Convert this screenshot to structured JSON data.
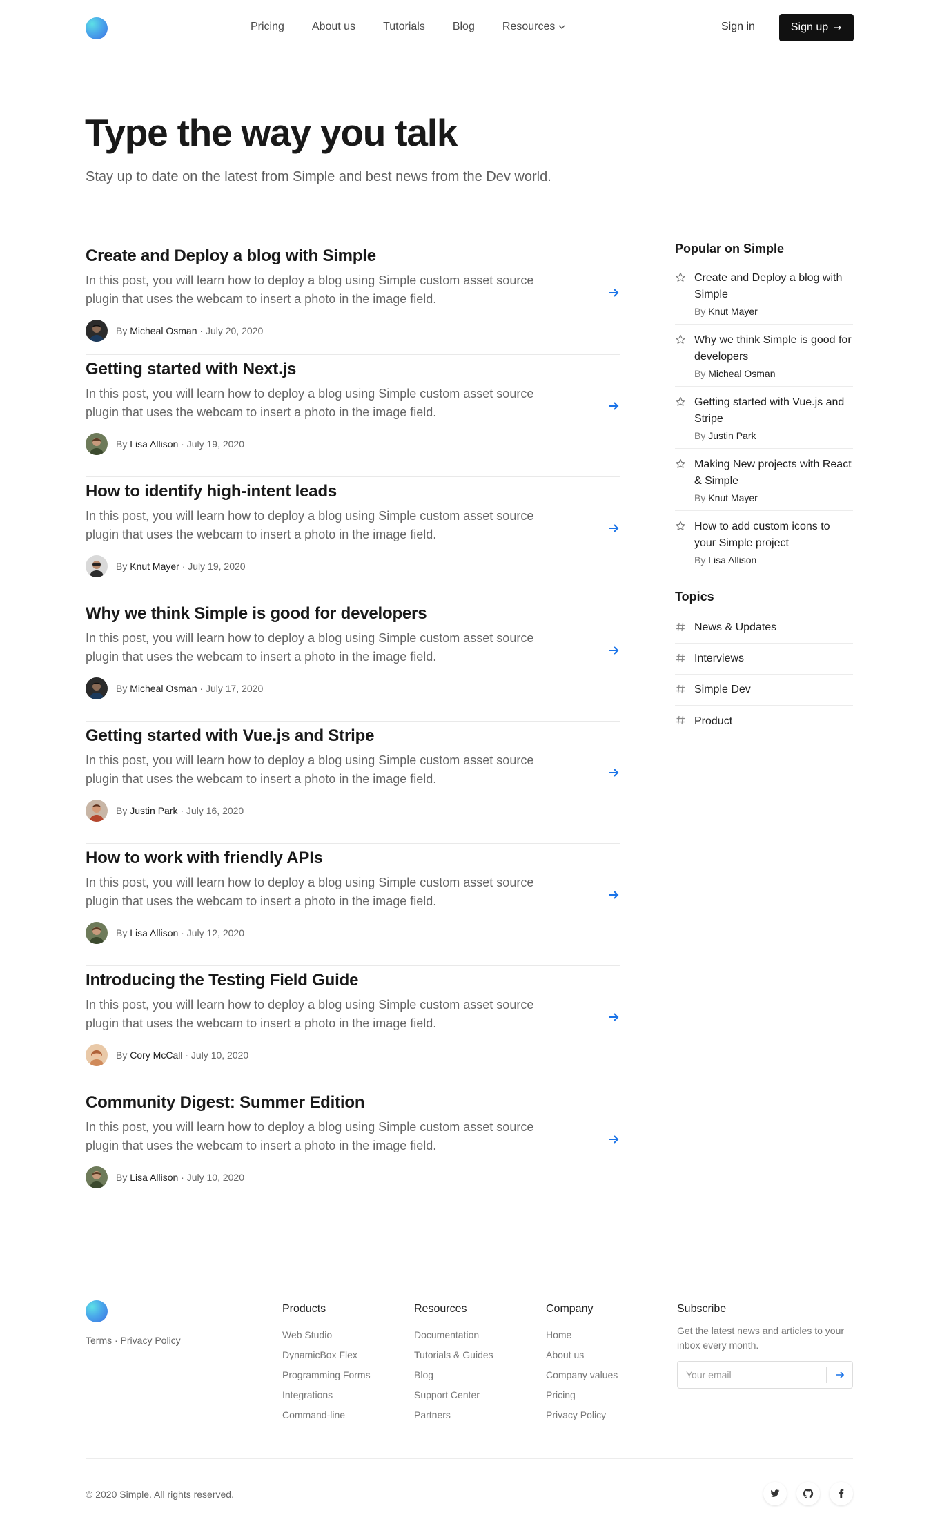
{
  "header": {
    "nav": [
      "Pricing",
      "About us",
      "Tutorials",
      "Blog",
      "Resources"
    ],
    "sign_in": "Sign in",
    "sign_up": "Sign up"
  },
  "hero": {
    "title": "Type the way you talk",
    "subtitle": "Stay up to date on the latest from Simple and best news from the Dev world."
  },
  "posts": [
    {
      "title": "Create and Deploy a blog with Simple",
      "desc": "In this post, you will learn how to deploy a blog using Simple custom asset source plugin that uses the webcam to insert a photo in the image field.",
      "by": "By",
      "author": "Micheal Osman",
      "date": "· July 20, 2020"
    },
    {
      "title": "Getting started with Next.js",
      "desc": "In this post, you will learn how to deploy a blog using Simple custom asset source plugin that uses the webcam to insert a photo in the image field.",
      "by": "By",
      "author": "Lisa Allison",
      "date": "· July 19, 2020"
    },
    {
      "title": "How to identify high-intent leads",
      "desc": "In this post, you will learn how to deploy a blog using Simple custom asset source plugin that uses the webcam to insert a photo in the image field.",
      "by": "By",
      "author": "Knut Mayer",
      "date": "· July 19, 2020"
    },
    {
      "title": "Why we think Simple is good for developers",
      "desc": "In this post, you will learn how to deploy a blog using Simple custom asset source plugin that uses the webcam to insert a photo in the image field.",
      "by": "By",
      "author": "Micheal Osman",
      "date": "· July 17, 2020"
    },
    {
      "title": "Getting started with Vue.js and Stripe",
      "desc": "In this post, you will learn how to deploy a blog using Simple custom asset source plugin that uses the webcam to insert a photo in the image field.",
      "by": "By",
      "author": "Justin Park",
      "date": "· July 16, 2020"
    },
    {
      "title": "How to work with friendly APIs",
      "desc": "In this post, you will learn how to deploy a blog using Simple custom asset source plugin that uses the webcam to insert a photo in the image field.",
      "by": "By",
      "author": "Lisa Allison",
      "date": "· July 12, 2020"
    },
    {
      "title": "Introducing the Testing Field Guide",
      "desc": "In this post, you will learn how to deploy a blog using Simple custom asset source plugin that uses the webcam to insert a photo in the image field.",
      "by": "By",
      "author": "Cory McCall",
      "date": "· July 10, 2020"
    },
    {
      "title": "Community Digest: Summer Edition",
      "desc": "In this post, you will learn how to deploy a blog using Simple custom asset source plugin that uses the webcam to insert a photo in the image field.",
      "by": "By",
      "author": "Lisa Allison",
      "date": "· July 10, 2020"
    }
  ],
  "sidebar": {
    "popular_heading": "Popular on Simple",
    "popular": [
      {
        "title": "Create and Deploy a blog with Simple",
        "by": "By",
        "author": "Knut Mayer"
      },
      {
        "title": "Why we think Simple is good for developers",
        "by": "By",
        "author": "Micheal Osman"
      },
      {
        "title": "Getting started with Vue.js and Stripe",
        "by": "By",
        "author": "Justin Park"
      },
      {
        "title": "Making New projects with React & Simple",
        "by": "By",
        "author": "Knut Mayer"
      },
      {
        "title": "How to add custom icons to your Simple project",
        "by": "By",
        "author": "Lisa Allison"
      }
    ],
    "topics_heading": "Topics",
    "topics": [
      "News & Updates",
      "Interviews",
      "Simple Dev",
      "Product"
    ]
  },
  "footer": {
    "legal": "Terms · Privacy Policy",
    "products": {
      "heading": "Products",
      "links": [
        "Web Studio",
        "DynamicBox Flex",
        "Programming Forms",
        "Integrations",
        "Command-line"
      ]
    },
    "resources": {
      "heading": "Resources",
      "links": [
        "Documentation",
        "Tutorials & Guides",
        "Blog",
        "Support Center",
        "Partners"
      ]
    },
    "company": {
      "heading": "Company",
      "links": [
        "Home",
        "About us",
        "Company values",
        "Pricing",
        "Privacy Policy"
      ]
    },
    "subscribe": {
      "heading": "Subscribe",
      "desc": "Get the latest news and articles to your inbox every month.",
      "placeholder": "Your email"
    },
    "copyright": "© 2020 Simple. All rights reserved."
  },
  "colors": {
    "accent": "#1a73e8",
    "button": "#111111"
  }
}
